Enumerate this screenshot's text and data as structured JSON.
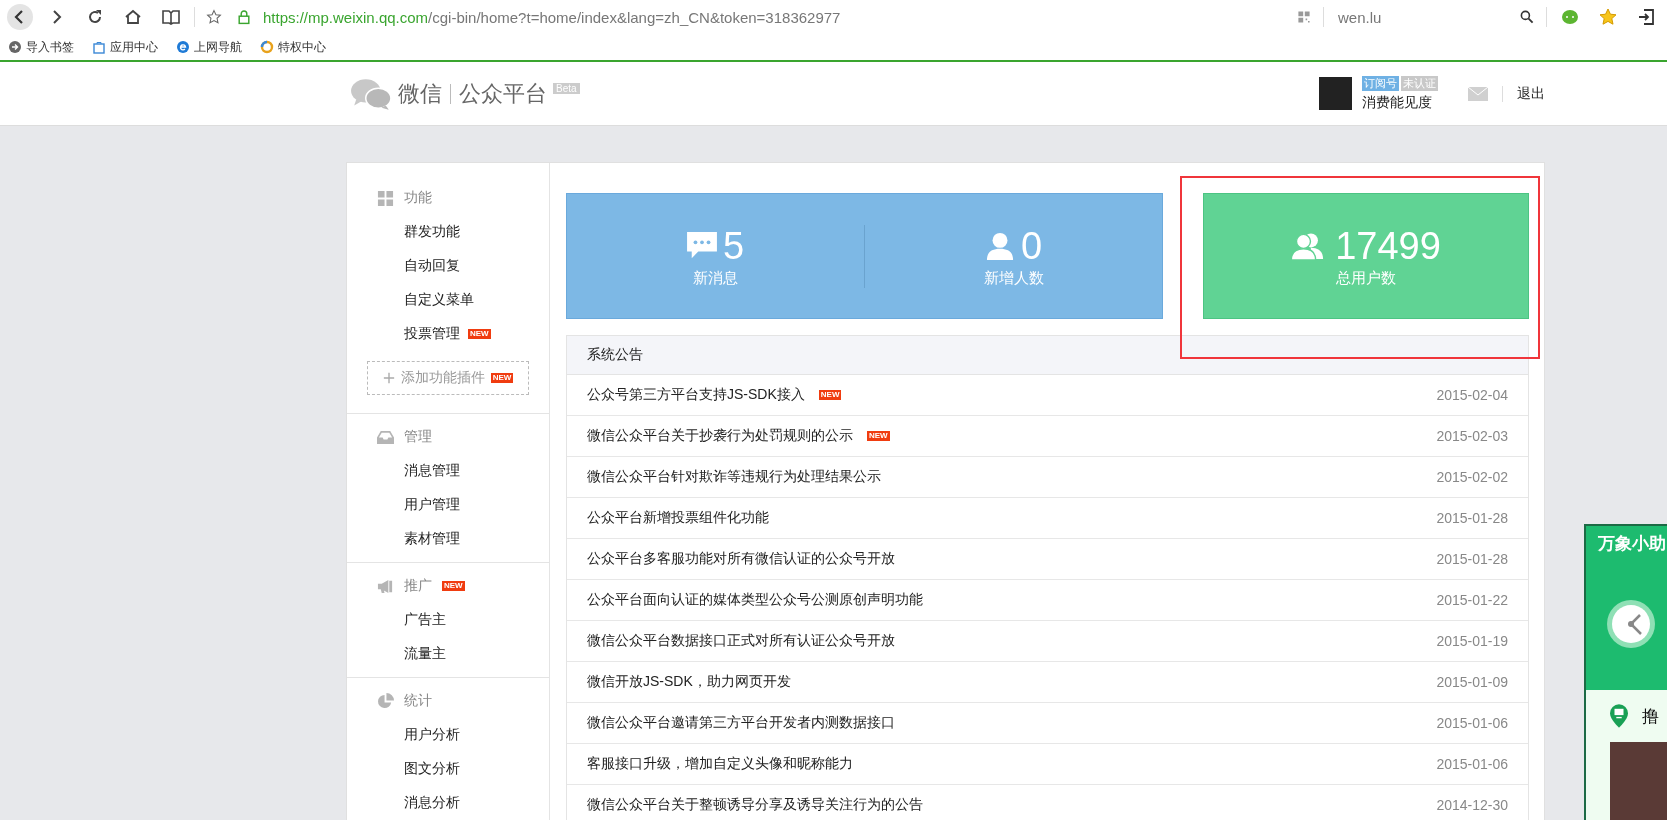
{
  "browser": {
    "url_host": "https://mp.weixin.qq.com",
    "url_path": "/cgi-bin/home?t=home/index&lang=zh_CN&token=318362977",
    "search": "wen.lu"
  },
  "bookmarks": [
    {
      "label": "导入书签",
      "kind": "import"
    },
    {
      "label": "应用中心",
      "kind": "bag"
    },
    {
      "label": "上网导航",
      "kind": "ie"
    },
    {
      "label": "特权中心",
      "kind": "ring"
    }
  ],
  "header": {
    "logo": "微信",
    "product": "公众平台",
    "beta": "Beta",
    "tags": [
      "订阅号",
      "未认证"
    ],
    "account": "消费能见度",
    "logout": "退出"
  },
  "sidebar": [
    {
      "title": "功能",
      "kind": "grid",
      "items": [
        {
          "label": "群发功能"
        },
        {
          "label": "自动回复"
        },
        {
          "label": "自定义菜单"
        },
        {
          "label": "投票管理",
          "badge": "NEW"
        }
      ],
      "add_plugin": {
        "label": "添加功能插件",
        "badge": "NEW"
      }
    },
    {
      "title": "管理",
      "kind": "tray",
      "items": [
        {
          "label": "消息管理"
        },
        {
          "label": "用户管理"
        },
        {
          "label": "素材管理"
        }
      ]
    },
    {
      "title": "推广",
      "kind": "megaphone",
      "badge": "NEW",
      "items": [
        {
          "label": "广告主"
        },
        {
          "label": "流量主"
        }
      ]
    },
    {
      "title": "统计",
      "kind": "pie",
      "items": [
        {
          "label": "用户分析"
        },
        {
          "label": "图文分析"
        },
        {
          "label": "消息分析"
        }
      ]
    }
  ],
  "stats": [
    {
      "kind": "message",
      "value": "5",
      "label": "新消息"
    },
    {
      "kind": "user",
      "value": "0",
      "label": "新增人数"
    }
  ],
  "total": {
    "kind": "users",
    "value": "17499",
    "label": "总用户数",
    "highlighted": true
  },
  "notices": {
    "title": "系统公告",
    "rows": [
      {
        "title": "公众号第三方平台支持JS-SDK接入",
        "badge": "NEW",
        "date": "2015-02-04"
      },
      {
        "title": "微信公众平台关于抄袭行为处罚规则的公示",
        "badge": "NEW",
        "date": "2015-02-03"
      },
      {
        "title": "微信公众平台针对欺诈等违规行为处理结果公示",
        "date": "2015-02-02"
      },
      {
        "title": "公众平台新增投票组件化功能",
        "date": "2015-01-28"
      },
      {
        "title": "公众平台多客服功能对所有微信认证的公众号开放",
        "date": "2015-01-28"
      },
      {
        "title": "公众平台面向认证的媒体类型公众号公测原创声明功能",
        "date": "2015-01-22"
      },
      {
        "title": "微信公众平台数据接口正式对所有认证公众号开放",
        "date": "2015-01-19"
      },
      {
        "title": "微信开放JS-SDK，助力网页开发",
        "date": "2015-01-09"
      },
      {
        "title": "微信公众平台邀请第三方平台开发者内测数据接口",
        "date": "2015-01-06"
      },
      {
        "title": "客服接口升级，增加自定义头像和昵称能力",
        "date": "2015-01-06"
      },
      {
        "title": "微信公众平台关于整顿诱导分享及诱导关注行为的公告",
        "date": "2014-12-30"
      }
    ]
  },
  "popup": {
    "title": "万象小助",
    "line": "撸"
  }
}
